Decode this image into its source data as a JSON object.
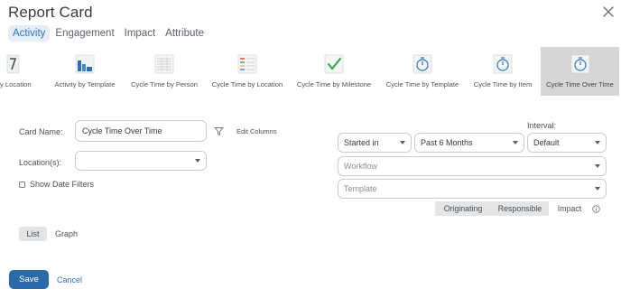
{
  "window": {
    "title": "Report Card"
  },
  "tabs": [
    {
      "label": "Activity",
      "active": true
    },
    {
      "label": "Engagement",
      "active": false
    },
    {
      "label": "Impact",
      "active": false
    },
    {
      "label": "Attribute",
      "active": false
    }
  ],
  "report_types": [
    {
      "label": "y Location",
      "icon": "partial-report-icon"
    },
    {
      "label": "Activity by Template",
      "icon": "bar-chart-icon"
    },
    {
      "label": "Cycle Time by Person",
      "icon": "table-report-icon"
    },
    {
      "label": "Cycle Time by Location",
      "icon": "colored-table-icon"
    },
    {
      "label": "Cycle Time by Milestone",
      "icon": "checkmark-report-icon"
    },
    {
      "label": "Cycle Time by Template",
      "icon": "stopwatch-icon"
    },
    {
      "label": "Cycle Time by Item",
      "icon": "stopwatch-icon"
    },
    {
      "label": "Cycle Time Over Time",
      "icon": "stopwatch-icon",
      "selected": true
    }
  ],
  "form": {
    "card_name_label": "Card Name:",
    "card_name_value": "Cycle Time Over Time",
    "edit_columns": "Edit Columns",
    "locations_label": "Location(s):",
    "locations_value": "",
    "show_date_filters": "Show Date Filters",
    "show_date_filters_checked": false
  },
  "filters": {
    "interval_label": "Interval:",
    "date_field": "Started in",
    "date_range": "Past 6 Months",
    "interval": "Default",
    "workflow_placeholder": "Workflow",
    "template_placeholder": "Template"
  },
  "impact_toggle": {
    "options": [
      "Originating",
      "Responsible",
      "Impact"
    ]
  },
  "view": {
    "list": "List",
    "graph": "Graph",
    "active": "List"
  },
  "footer": {
    "save": "Save",
    "cancel": "Cancel"
  },
  "colors": {
    "accent": "#2b6aa8",
    "tab_active_bg": "#e6eef7",
    "selected_card_bg": "#d6d6d6"
  }
}
